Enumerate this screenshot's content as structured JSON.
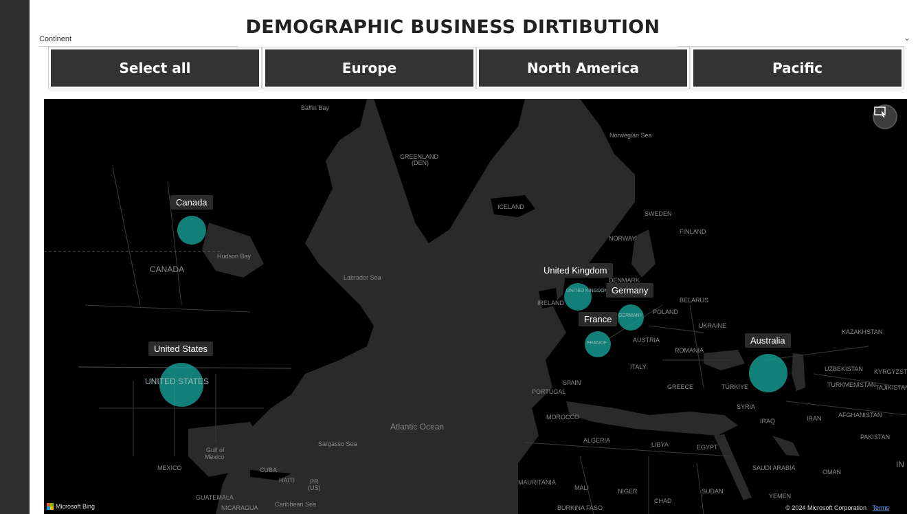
{
  "title": "DEMOGRAPHIC BUSINESS DIRTIBUTION",
  "slicer": {
    "label": "Continent",
    "buttons": [
      "Select all",
      "Europe",
      "North America",
      "Pacific"
    ]
  },
  "map": {
    "locations": [
      {
        "name": "Canada"
      },
      {
        "name": "United States"
      },
      {
        "name": "United Kingdom"
      },
      {
        "name": "Germany"
      },
      {
        "name": "France"
      },
      {
        "name": "Australia"
      }
    ],
    "geo_labels": {
      "baffin_bay": "Baffin Bay",
      "greenland": "GREENLAND",
      "greenland_den": "(DEN)",
      "norwegian_sea": "Norwegian Sea",
      "iceland": "ICELAND",
      "sweden": "SWEDEN",
      "finland": "FINLAND",
      "norway": "NORWAY",
      "hudson_bay": "Hudson Bay",
      "canada": "CANADA",
      "labrador_sea": "Labrador Sea",
      "denmark": "DENMARK",
      "ireland": "IRELAND",
      "united_kingdom_map": "UNITED KINGDOM",
      "belarus": "BELARUS",
      "poland": "POLAND",
      "germany_map": "GERMANY",
      "ukraine": "UKRAINE",
      "kazakhstan": "KAZAKHSTAN",
      "austria": "AUSTRIA",
      "france_map": "FRANCE",
      "romania": "ROMANIA",
      "uzbekistan": "UZBEKISTAN",
      "kyrgyzstan": "KYRGYZSTA",
      "italy": "ITALY",
      "spain": "SPAIN",
      "greece": "GREECE",
      "turkiye": "TÜRKIYE",
      "turkmenistan": "TURKMENISTAN",
      "tajikistan": "TAJIKISTAN",
      "portugal": "PORTUGAL",
      "syria": "SYRIA",
      "iraq": "IRAQ",
      "iran": "IRAN",
      "afghanistan": "AFGHANISTAN",
      "pakistan": "PAKISTAN",
      "united_states_map": "UNITED STATES",
      "morocco": "MOROCCO",
      "algeria": "ALGERIA",
      "libya": "LIBYA",
      "egypt": "EGYPT",
      "saudi_arabia": "SAUDI ARABIA",
      "oman": "OMAN",
      "atlantic_ocean": "Atlantic Ocean",
      "sargasso_sea": "Sargasso Sea",
      "gulf_of_mexico": "Gulf of",
      "gulf_of_mexico_2": "Mexico",
      "mexico": "MEXICO",
      "cuba": "CUBA",
      "haiti": "HAITI",
      "pr": "PR",
      "us": "(US)",
      "mauritania": "MAURITANIA",
      "mali": "MALI",
      "niger": "NIGER",
      "sudan": "SUDAN",
      "chad": "CHAD",
      "yemen": "YEMEN",
      "guatemala": "GUATEMALA",
      "nicaragua": "NICARAGUA",
      "caribbean_sea": "Caribbean Sea",
      "burkina_faso": "BURKINA FASO",
      "india_partial": "IN"
    },
    "attribution": "Microsoft Bing",
    "copyright": "© 2024 Microsoft Corporation",
    "terms": "Terms"
  },
  "colors": {
    "bubble": "#16a096",
    "button_bg": "#333333",
    "map_bg": "#2a2a2a",
    "land": "#000000"
  }
}
